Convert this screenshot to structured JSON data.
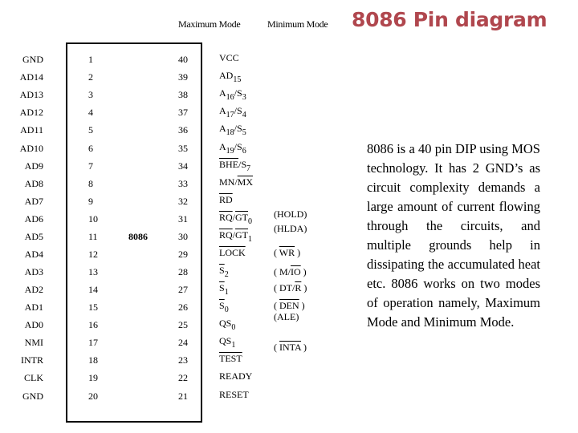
{
  "title": "8086 Pin diagram",
  "headers": {
    "max_mode": "Maximum Mode",
    "min_mode": "Minimum Mode"
  },
  "chip_name": "8086",
  "left_pins": [
    {
      "num": "1",
      "name": "GND"
    },
    {
      "num": "2",
      "name": "AD14"
    },
    {
      "num": "3",
      "name": "AD13"
    },
    {
      "num": "4",
      "name": "AD12"
    },
    {
      "num": "5",
      "name": "AD11"
    },
    {
      "num": "6",
      "name": "AD10"
    },
    {
      "num": "7",
      "name": "AD9"
    },
    {
      "num": "8",
      "name": "AD8"
    },
    {
      "num": "9",
      "name": "AD7"
    },
    {
      "num": "10",
      "name": "AD6"
    },
    {
      "num": "11",
      "name": "AD5"
    },
    {
      "num": "12",
      "name": "AD4"
    },
    {
      "num": "13",
      "name": "AD3"
    },
    {
      "num": "14",
      "name": "AD2"
    },
    {
      "num": "15",
      "name": "AD1"
    },
    {
      "num": "16",
      "name": "AD0"
    },
    {
      "num": "17",
      "name": "NMI"
    },
    {
      "num": "18",
      "name": "INTR"
    },
    {
      "num": "19",
      "name": "CLK"
    },
    {
      "num": "20",
      "name": "GND"
    }
  ],
  "right_pins": [
    {
      "num": "40",
      "max": "VCC",
      "min": ""
    },
    {
      "num": "39",
      "max": "AD15",
      "min": ""
    },
    {
      "num": "38",
      "max": "A16/S3",
      "min": ""
    },
    {
      "num": "37",
      "max": "A17/S4",
      "min": ""
    },
    {
      "num": "36",
      "max": "A18/S5",
      "min": ""
    },
    {
      "num": "35",
      "max": "A19/S6",
      "min": ""
    },
    {
      "num": "34",
      "max": "BHE/S7",
      "min": ""
    },
    {
      "num": "33",
      "max": "MN/MX",
      "min": ""
    },
    {
      "num": "32",
      "max": "RD",
      "min": ""
    },
    {
      "num": "31",
      "max": "RQ/GT0",
      "min": "(HOLD)"
    },
    {
      "num": "30",
      "max": "RQ/GT1",
      "min": "(HLDA)"
    },
    {
      "num": "29",
      "max": "LOCK",
      "min": "(WR)"
    },
    {
      "num": "28",
      "max": "S2",
      "min": "(M/IO)"
    },
    {
      "num": "27",
      "max": "S1",
      "min": "(DT/R)"
    },
    {
      "num": "26",
      "max": "S0",
      "min": "(DEN)"
    },
    {
      "num": "25",
      "max": "QS0",
      "min": "(ALE)"
    },
    {
      "num": "24",
      "max": "QS1",
      "min": "(INTA)"
    },
    {
      "num": "23",
      "max": "TEST",
      "min": ""
    },
    {
      "num": "22",
      "max": "READY",
      "min": ""
    },
    {
      "num": "21",
      "max": "RESET",
      "min": ""
    }
  ],
  "description": "8086 is a 40 pin DIP using MOS technology. It has 2 GND’s as circuit complexity demands a large amount of current flowing through the circuits, and multiple grounds help in dissipating the accumulated heat etc. 8086 works on two modes of operation namely, Maximum Mode and Minimum Mode."
}
